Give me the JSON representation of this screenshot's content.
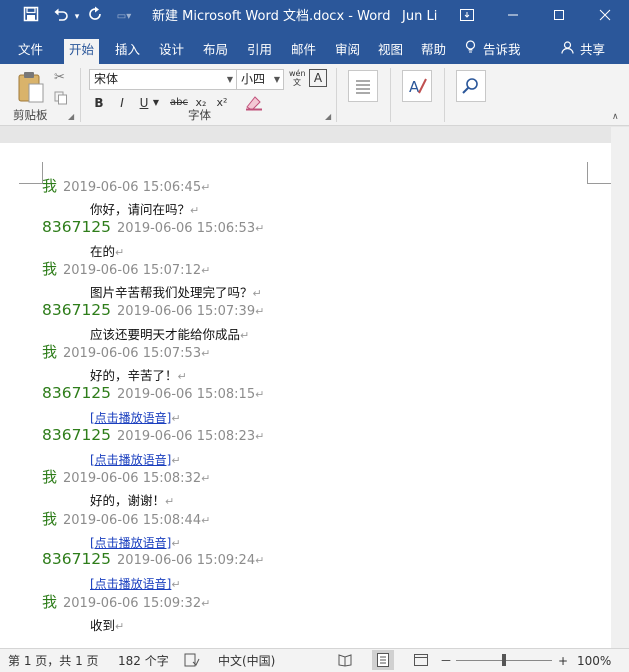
{
  "titlebar": {
    "title": "新建 Microsoft Word 文档.docx  -  Word",
    "user": "Jun Li",
    "bg_color": "#2b579a"
  },
  "tabs": [
    {
      "label": "文件",
      "active": false
    },
    {
      "label": "开始",
      "active": true
    },
    {
      "label": "插入",
      "active": false
    },
    {
      "label": "设计",
      "active": false
    },
    {
      "label": "布局",
      "active": false
    },
    {
      "label": "引用",
      "active": false
    },
    {
      "label": "邮件",
      "active": false
    },
    {
      "label": "审阅",
      "active": false
    },
    {
      "label": "视图",
      "active": false
    },
    {
      "label": "帮助",
      "active": false
    }
  ],
  "tell_me": "告诉我",
  "share": "共享",
  "ribbon": {
    "clipboard_label": "剪贴板",
    "font_label": "字体",
    "font_name": "宋体",
    "font_size": "小四",
    "format_buttons": [
      "B",
      "I",
      "U",
      "abc",
      "x₂",
      "x²"
    ],
    "phonetic_glyph": "wén"
  },
  "document": {
    "pilcrow": "↵",
    "entries": [
      {
        "sender": "我",
        "time": "2019-06-06 15:06:45",
        "type": "text",
        "content": "你好，请问在吗？"
      },
      {
        "sender": "8367125",
        "time": "2019-06-06 15:06:53",
        "type": "text",
        "content": "在的"
      },
      {
        "sender": "我",
        "time": "2019-06-06 15:07:12",
        "type": "text",
        "content": "图片辛苦帮我们处理完了吗？"
      },
      {
        "sender": "8367125",
        "time": "2019-06-06 15:07:39",
        "type": "text",
        "content": "应该还要明天才能给你成品"
      },
      {
        "sender": "我",
        "time": "2019-06-06 15:07:53",
        "type": "text",
        "content": "好的，辛苦了！"
      },
      {
        "sender": "8367125",
        "time": "2019-06-06 15:08:15",
        "type": "link",
        "content": "[点击播放语音]"
      },
      {
        "sender": "8367125",
        "time": "2019-06-06 15:08:23",
        "type": "link",
        "content": "[点击播放语音]"
      },
      {
        "sender": "我",
        "time": "2019-06-06 15:08:32",
        "type": "text",
        "content": "好的，谢谢！"
      },
      {
        "sender": "我",
        "time": "2019-06-06 15:08:44",
        "type": "link",
        "content": "[点击播放语音]"
      },
      {
        "sender": "8367125",
        "time": "2019-06-06 15:09:24",
        "type": "link",
        "content": "[点击播放语音]"
      },
      {
        "sender": "我",
        "time": "2019-06-06 15:09:32",
        "type": "text",
        "content": "收到"
      }
    ]
  },
  "statusbar": {
    "page": "第 1 页，共 1 页",
    "words": "182 个字",
    "language": "中文(中国)",
    "zoom": "100%",
    "zoom_minus": "－",
    "zoom_plus": "+",
    "zoom_level": 1.0
  }
}
